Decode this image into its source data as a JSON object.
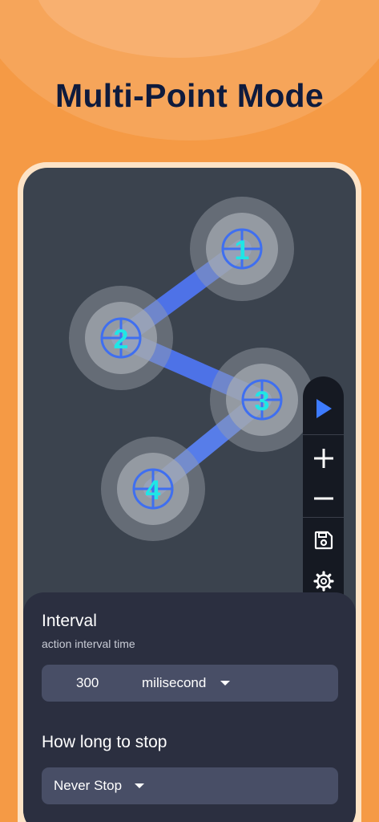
{
  "promo": {
    "title": "Multi-Point Mode"
  },
  "points": [
    {
      "label": "1"
    },
    {
      "label": "2"
    },
    {
      "label": "3"
    },
    {
      "label": "4"
    }
  ],
  "toolbar": {
    "icons": [
      "play-icon",
      "plus-icon",
      "minus-icon",
      "save-icon",
      "gear-icon"
    ]
  },
  "settings": {
    "interval": {
      "title": "Interval",
      "subtitle": "action interval time",
      "value": "300",
      "unit": "milisecond"
    },
    "stop": {
      "title": "How long to stop",
      "value": "Never Stop"
    }
  },
  "colors": {
    "background": "#f59a45",
    "title": "#0f1b3d",
    "accent": "#4a7bff",
    "point_label": "#1fe6e6"
  }
}
